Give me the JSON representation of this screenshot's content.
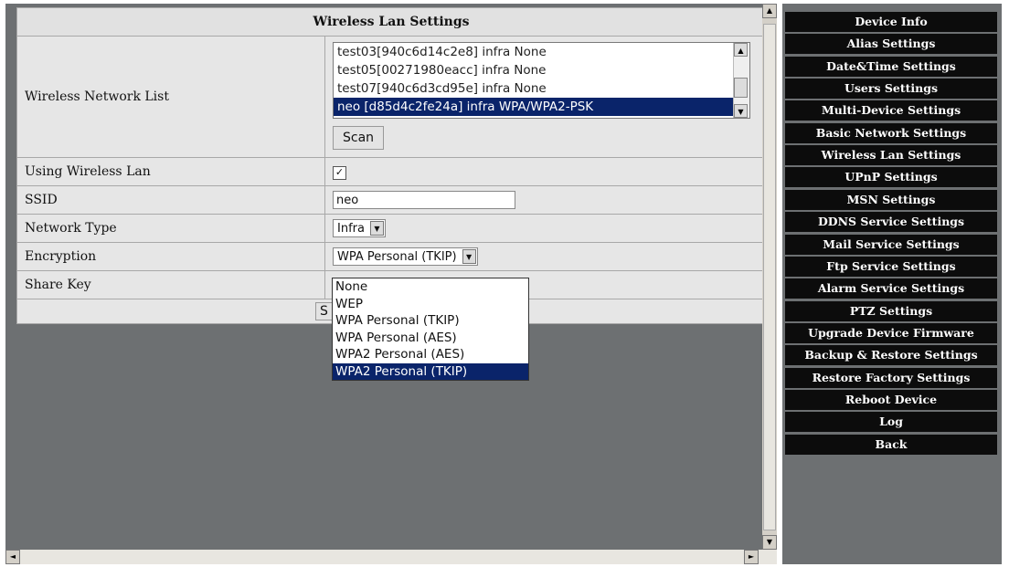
{
  "page": {
    "heading": "Wireless Lan Settings"
  },
  "network_list": {
    "label": "Wireless Network List",
    "items": [
      "test03[940c6d14c2e8] infra None",
      "test05[00271980eacc] infra None",
      "test07[940c6d3cd95e] infra None",
      "neo [d85d4c2fe24a] infra WPA/WPA2-PSK"
    ],
    "selected_index": 3,
    "scan_label": "Scan"
  },
  "fields": {
    "using_wireless_label": "Using Wireless Lan",
    "using_wireless_checked": "✓",
    "ssid_label": "SSID",
    "ssid_value": "neo",
    "network_type_label": "Network Type",
    "network_type_value": "Infra",
    "encryption_label": "Encryption",
    "encryption_value": "WPA Personal (TKIP)",
    "share_key_label": "Share Key"
  },
  "save_button": {
    "label": "S"
  },
  "encryption_options": [
    "None",
    "WEP",
    "WPA Personal (TKIP)",
    "WPA Personal (AES)",
    "WPA2 Personal (AES)",
    "WPA2 Personal (TKIP)"
  ],
  "encryption_highlighted": 5,
  "menu": [
    "Device Info",
    "Alias Settings",
    "Date&Time Settings",
    "Users Settings",
    "Multi-Device Settings",
    "Basic Network Settings",
    "Wireless Lan Settings",
    "UPnP Settings",
    "MSN Settings",
    "DDNS Service Settings",
    "Mail Service Settings",
    "Ftp Service Settings",
    "Alarm Service Settings",
    "PTZ Settings",
    "Upgrade Device Firmware",
    "Backup & Restore Settings",
    "Restore Factory Settings",
    "Reboot Device",
    "Log",
    "Back"
  ],
  "colors": {
    "menu_bg": "#0c0c0c",
    "panel_bg": "#6d7072",
    "selection": "#0a246a"
  }
}
